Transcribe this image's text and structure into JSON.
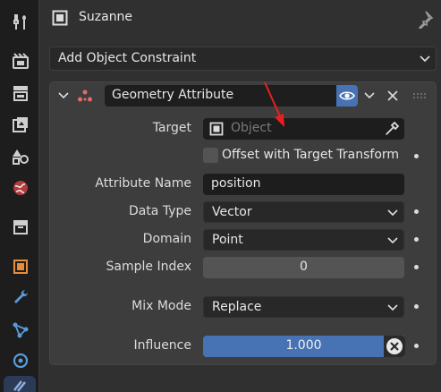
{
  "sidebar": {
    "tabs": [
      {
        "icon": "tool-icon"
      },
      {
        "icon": "render-icon"
      },
      {
        "icon": "output-icon"
      },
      {
        "icon": "view-layer-icon"
      },
      {
        "icon": "scene-icon"
      },
      {
        "icon": "world-icon"
      },
      {
        "icon": "collection-icon"
      },
      {
        "icon": "object-icon"
      },
      {
        "icon": "modifier-wrench-icon"
      },
      {
        "icon": "particles-icon"
      },
      {
        "icon": "physics-icon"
      },
      {
        "icon": "constraint-icon"
      }
    ]
  },
  "header": {
    "object_name": "Suzanne"
  },
  "add_constraint": {
    "label": "Add Object Constraint"
  },
  "constraint": {
    "name": "Geometry Attribute",
    "visible": true,
    "target": {
      "label": "Target",
      "placeholder": "Object"
    },
    "offset": {
      "label": "Offset with Target Transform",
      "checked": false
    },
    "attribute_name": {
      "label": "Attribute Name",
      "value": "position"
    },
    "data_type": {
      "label": "Data Type",
      "value": "Vector"
    },
    "domain": {
      "label": "Domain",
      "value": "Point"
    },
    "sample_index": {
      "label": "Sample Index",
      "value": "0"
    },
    "mix_mode": {
      "label": "Mix Mode",
      "value": "Replace"
    },
    "influence": {
      "label": "Influence",
      "value": "1.000",
      "fraction": 1.0
    }
  },
  "colors": {
    "accent": "#4772b3",
    "annotation_arrow": "#e8201f"
  }
}
